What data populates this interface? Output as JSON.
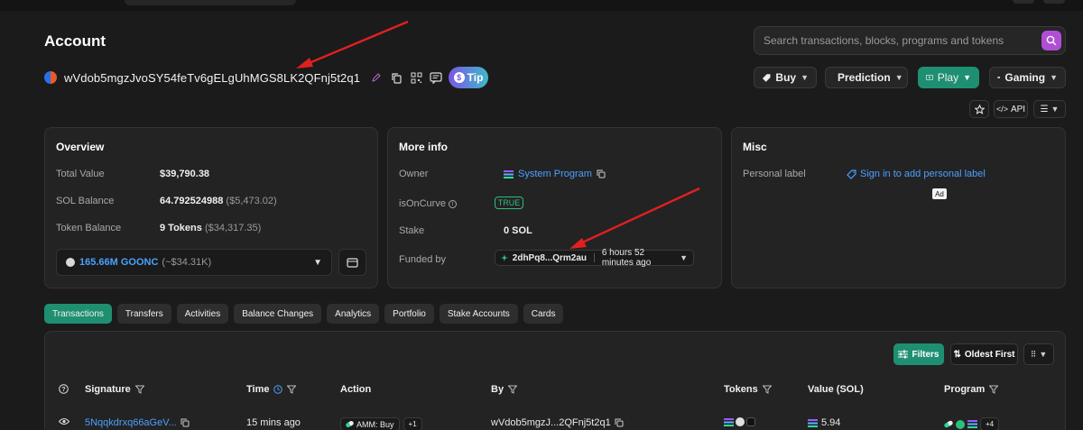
{
  "header": {
    "title": "Account",
    "search_placeholder": "Search transactions, blocks, programs and tokens"
  },
  "account": {
    "address": "wVdob5mgzJvoSY54feTv6gELgUhMGS8LK2QFnj5t2q1",
    "tip_label": "Tip"
  },
  "toolbar": {
    "buy": "Buy",
    "prediction": "Prediction",
    "play": "Play",
    "gaming": "Gaming",
    "api": "API"
  },
  "overview": {
    "title": "Overview",
    "total_value_label": "Total Value",
    "total_value": "$39,790.38",
    "sol_balance_label": "SOL Balance",
    "sol_balance": "64.792524988",
    "sol_balance_usd": "($5,473.02)",
    "token_balance_label": "Token Balance",
    "token_balance": "9 Tokens",
    "token_balance_usd": "($34,317.35)",
    "token_select_amount": "165.66M GOONC",
    "token_select_usd": "(~$34.31K)"
  },
  "more_info": {
    "title": "More info",
    "owner_label": "Owner",
    "owner_value": "System Program",
    "is_on_curve_label": "isOnCurve",
    "is_on_curve_value": "TRUE",
    "stake_label": "Stake",
    "stake_value": "0 SOL",
    "funded_by_label": "Funded by",
    "funded_by_address": "2dhPq8...Qrm2au",
    "funded_by_time": "6 hours 52 minutes ago"
  },
  "misc": {
    "title": "Misc",
    "personal_label_label": "Personal label",
    "personal_label_link": "Sign in to add personal label",
    "ad_badge": "Ad"
  },
  "tabs": [
    {
      "label": "Transactions",
      "active": true
    },
    {
      "label": "Transfers",
      "active": false
    },
    {
      "label": "Activities",
      "active": false
    },
    {
      "label": "Balance Changes",
      "active": false
    },
    {
      "label": "Analytics",
      "active": false
    },
    {
      "label": "Portfolio",
      "active": false
    },
    {
      "label": "Stake Accounts",
      "active": false
    },
    {
      "label": "Cards",
      "active": false
    }
  ],
  "table": {
    "filters_label": "Filters",
    "sort_label": "Oldest First",
    "columns": {
      "signature": "Signature",
      "time": "Time",
      "action": "Action",
      "by": "By",
      "tokens": "Tokens",
      "value": "Value (SOL)",
      "program": "Program"
    },
    "rows": [
      {
        "signature": "5Nqqkdrxq66aGeV...",
        "time": "15 mins ago",
        "action": "AMM: Buy",
        "action_more": "+1",
        "by": "wVdob5mgzJ...2QFnj5t2q1",
        "value": "5.94",
        "program_more": "+4"
      }
    ]
  },
  "colors": {
    "accent_green": "#1f8f72",
    "link_blue": "#4aa0ff",
    "search_purple": "#b04fd6",
    "annotation_red": "#e02020"
  }
}
